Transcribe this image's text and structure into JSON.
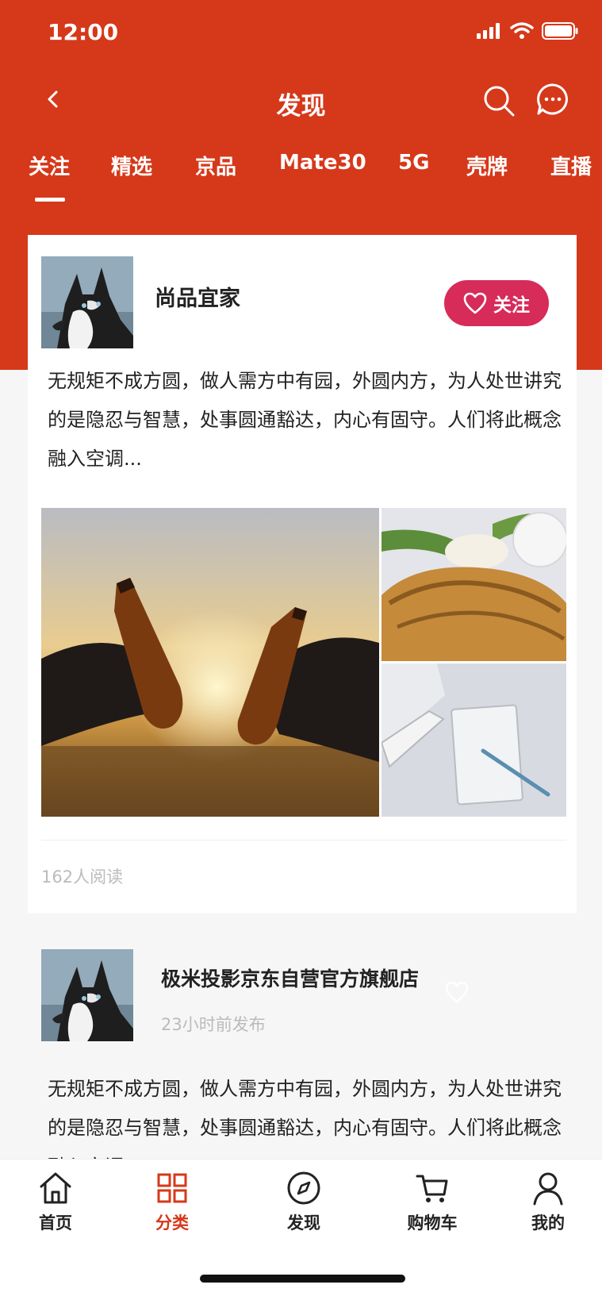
{
  "status_bar": {
    "time": "12:00"
  },
  "nav": {
    "title": "发现"
  },
  "tabs": [
    {
      "label": "关注"
    },
    {
      "label": "精选"
    },
    {
      "label": "京品"
    },
    {
      "label": "Mate30"
    },
    {
      "label": "5G"
    },
    {
      "label": "壳牌"
    },
    {
      "label": "直播"
    }
  ],
  "active_tab": 0,
  "posts": [
    {
      "author": "尚品宜家",
      "follow_label": "关注",
      "text": "无规矩不成方圆，做人需方中有园，外圆内方，为人处世讲究的是隐忍与智慧，处事圆通豁达，内心有固守。人们将此概念融入空调...",
      "reads": "162人阅读",
      "images": [
        "sunset-beer-toast",
        "croissant-and-tulip",
        "laptop-and-notebook"
      ]
    },
    {
      "author": "极米投影京东自营官方旗舰店",
      "time": "23小时前发布",
      "text": "无规矩不成方圆，做人需方中有园，外圆内方，为人处世讲究的是隐忍与智慧，处事圆通豁达，内心有固守。人们将此概念融入空调..."
    }
  ],
  "tabbar": [
    {
      "label": "首页",
      "icon": "home-icon"
    },
    {
      "label": "分类",
      "icon": "grid-icon"
    },
    {
      "label": "发现",
      "icon": "compass-icon"
    },
    {
      "label": "购物车",
      "icon": "cart-icon"
    },
    {
      "label": "我的",
      "icon": "user-icon"
    }
  ],
  "active_tabbar": 1,
  "colors": {
    "brand": "#d6381a",
    "follow": "#d72b5a"
  }
}
